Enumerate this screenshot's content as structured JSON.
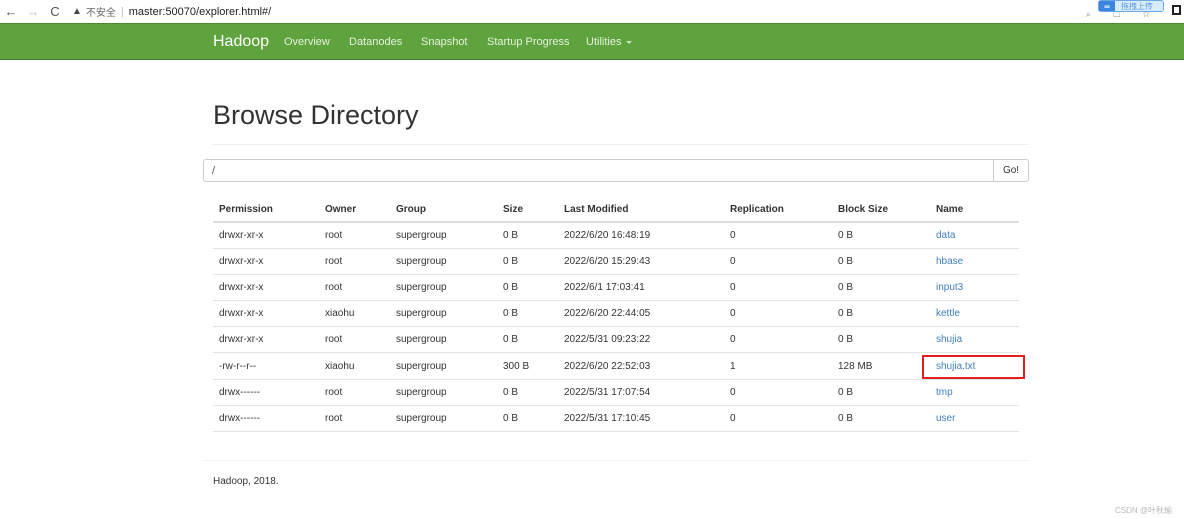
{
  "browser": {
    "back_icon": "←",
    "forward_icon": "→",
    "reload_icon": "C",
    "security_warning_icon": "▲",
    "security_label": "不安全",
    "separator": "|",
    "url": "master:50070/explorer.html#/",
    "extension_logo": "∞",
    "extension_label": "拖拽上传",
    "toolbar_icons": "⌕ ☐ ☆"
  },
  "navbar": {
    "brand": "Hadoop",
    "items": [
      {
        "label": "Overview"
      },
      {
        "label": "Datanodes"
      },
      {
        "label": "Snapshot"
      },
      {
        "label": "Startup Progress"
      },
      {
        "label": "Utilities"
      }
    ],
    "accent_color": "#5fa33e"
  },
  "page": {
    "title": "Browse Directory",
    "path_value": "/",
    "go_label": "Go!"
  },
  "table": {
    "headers": [
      "Permission",
      "Owner",
      "Group",
      "Size",
      "Last Modified",
      "Replication",
      "Block Size",
      "Name"
    ],
    "rows": [
      {
        "permission": "drwxr-xr-x",
        "owner": "root",
        "group": "supergroup",
        "size": "0 B",
        "modified": "2022/6/20 16:48:19",
        "replication": "0",
        "block_size": "0 B",
        "name": "data"
      },
      {
        "permission": "drwxr-xr-x",
        "owner": "root",
        "group": "supergroup",
        "size": "0 B",
        "modified": "2022/6/20 15:29:43",
        "replication": "0",
        "block_size": "0 B",
        "name": "hbase"
      },
      {
        "permission": "drwxr-xr-x",
        "owner": "root",
        "group": "supergroup",
        "size": "0 B",
        "modified": "2022/6/1 17:03:41",
        "replication": "0",
        "block_size": "0 B",
        "name": "input3"
      },
      {
        "permission": "drwxr-xr-x",
        "owner": "xiaohu",
        "group": "supergroup",
        "size": "0 B",
        "modified": "2022/6/20 22:44:05",
        "replication": "0",
        "block_size": "0 B",
        "name": "kettle"
      },
      {
        "permission": "drwxr-xr-x",
        "owner": "root",
        "group": "supergroup",
        "size": "0 B",
        "modified": "2022/5/31 09:23:22",
        "replication": "0",
        "block_size": "0 B",
        "name": "shujia"
      },
      {
        "permission": "-rw-r--r--",
        "owner": "xiaohu",
        "group": "supergroup",
        "size": "300 B",
        "modified": "2022/6/20 22:52:03",
        "replication": "1",
        "block_size": "128 MB",
        "name": "shujia.txt"
      },
      {
        "permission": "drwx------",
        "owner": "root",
        "group": "supergroup",
        "size": "0 B",
        "modified": "2022/5/31 17:07:54",
        "replication": "0",
        "block_size": "0 B",
        "name": "tmp"
      },
      {
        "permission": "drwx------",
        "owner": "root",
        "group": "supergroup",
        "size": "0 B",
        "modified": "2022/5/31 17:10:45",
        "replication": "0",
        "block_size": "0 B",
        "name": "user"
      }
    ]
  },
  "footer": {
    "text": "Hadoop, 2018."
  },
  "watermark": "CSDN @叶秋瑜"
}
